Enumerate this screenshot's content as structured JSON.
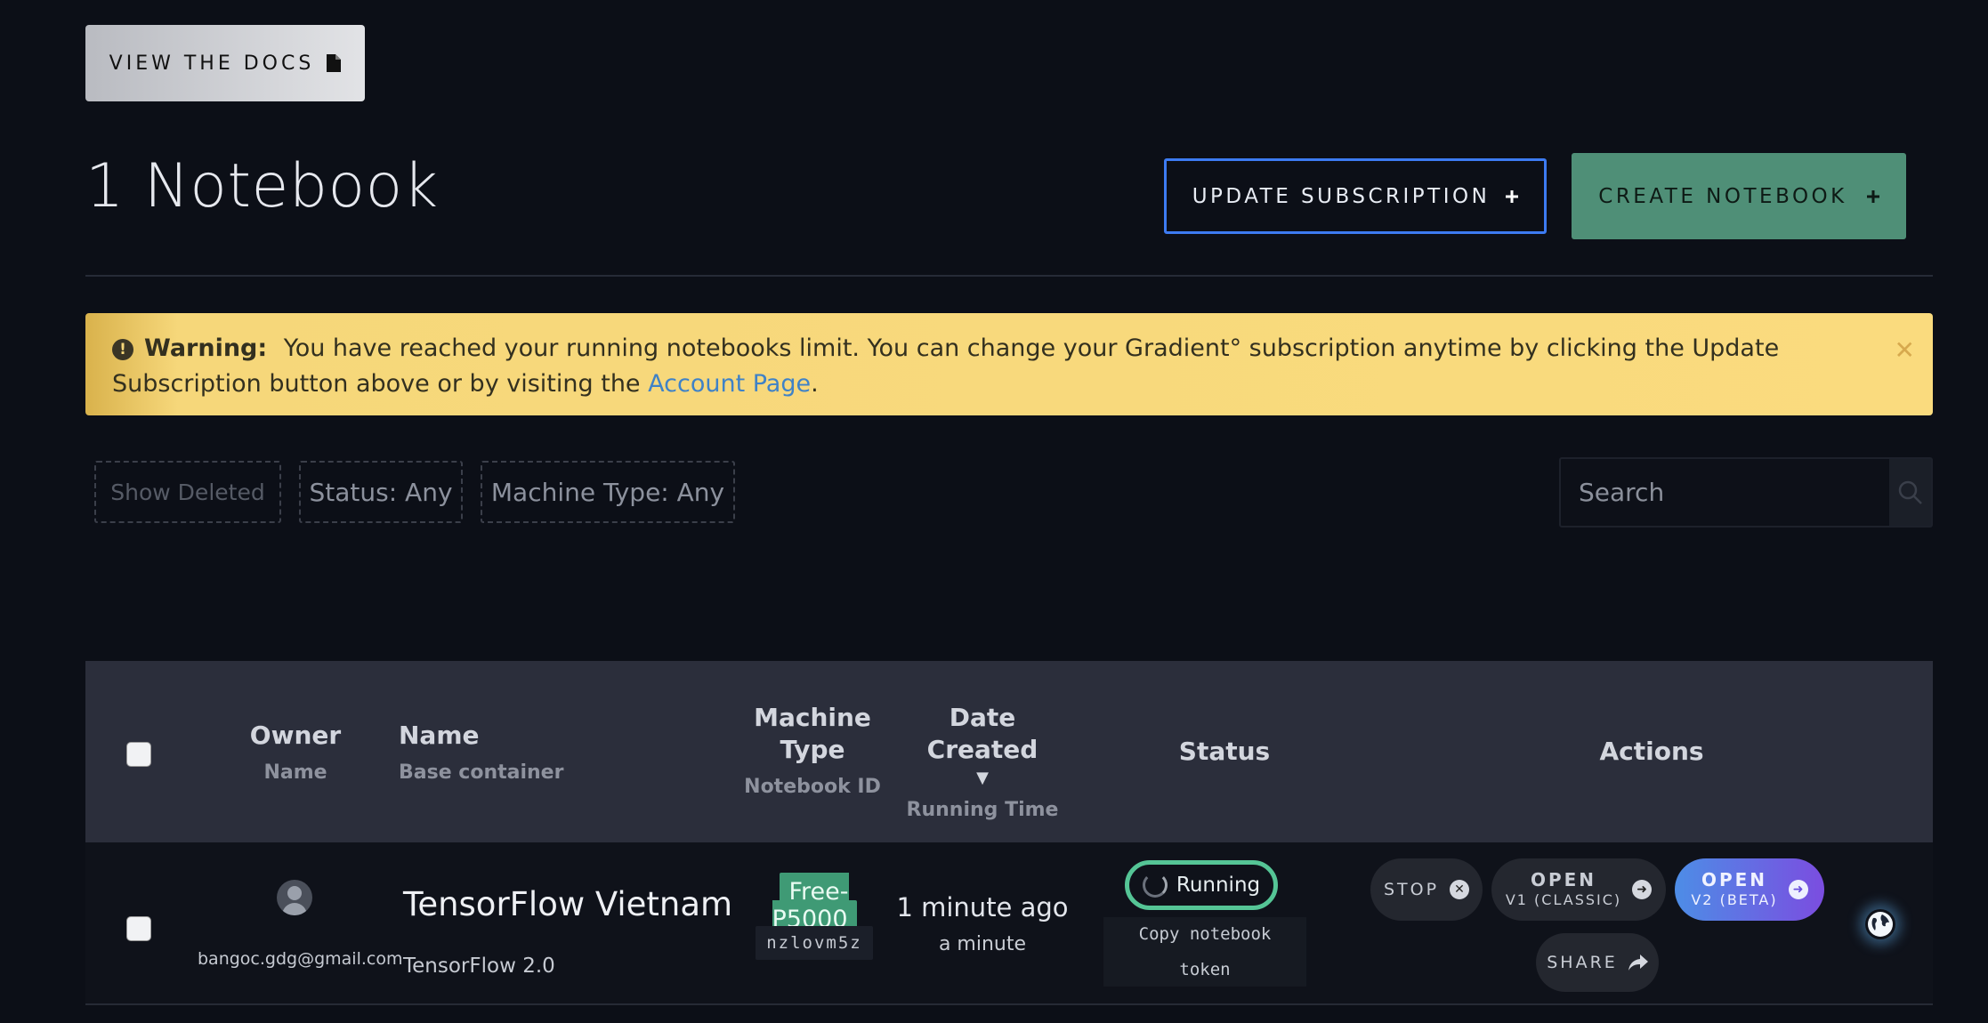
{
  "header": {
    "docs_button": "VIEW THE DOCS",
    "title": "1 Notebook",
    "update_button": "UPDATE SUBSCRIPTION",
    "create_button": "CREATE NOTEBOOK"
  },
  "warning": {
    "label": "Warning:",
    "text": "You have reached your running notebooks limit. You can change your Gradient° subscription anytime by clicking the Update Subscription button above or by visiting the",
    "link_text": "Account Page",
    "end": "."
  },
  "filters": {
    "show_deleted": "Show Deleted",
    "status": "Status: Any",
    "machine_type": "Machine Type: Any"
  },
  "search": {
    "placeholder": "Search"
  },
  "table": {
    "headers": {
      "owner": "Owner",
      "owner_sub": "Name",
      "name": "Name",
      "name_sub": "Base container",
      "machine_type": "Machine Type",
      "machine_type_sub": "Notebook ID",
      "date_created": "Date Created",
      "date_created_sub": "Running Time",
      "status": "Status",
      "actions": "Actions"
    },
    "rows": [
      {
        "owner_email": "bangoc.gdg@gmail.com",
        "name": "TensorFlow Vietnam",
        "container": "TensorFlow 2.0",
        "machine": "Free-P5000",
        "notebook_id": "nzlovm5z",
        "date_created": "1 minute ago",
        "running_time": "a minute",
        "status": "Running",
        "copy_token": "Copy notebook token",
        "actions": {
          "stop": "STOP",
          "open_v1": "OPEN",
          "open_v1_sub": "V1 (CLASSIC)",
          "open_v2": "OPEN",
          "open_v2_sub": "V2 (BETA)",
          "share": "SHARE"
        }
      }
    ]
  },
  "colors": {
    "background": "#0c0f17",
    "accent_blue": "#3d7bf2",
    "create_green": "#4f8f77",
    "warning_yellow": "#fadb7e",
    "running_green": "#55c596"
  }
}
